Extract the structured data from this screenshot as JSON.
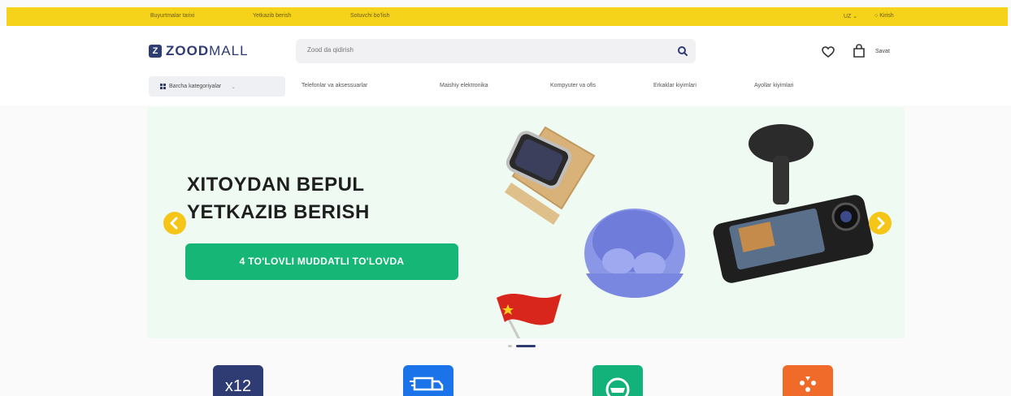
{
  "topbar": {
    "links": [
      "Buyurtmalar tarixi",
      "Yetkazib berish",
      "Sotuvchi bo'lish"
    ],
    "language": "UZ",
    "login": "Kirish"
  },
  "header": {
    "logo_mark": "Z",
    "logo_bold": "ZOOD",
    "logo_light": "MALL",
    "search_placeholder": "Zood da qidirish",
    "basket_label": "Savat"
  },
  "nav": {
    "all_categories": "Barcha kategoriyalar",
    "items": [
      "Telefonlar va aksessuarlar",
      "Maishiy elektronika",
      "Kompyuter va ofis",
      "Erkaklar kiyimlari",
      "Ayollar kiyimlari"
    ]
  },
  "banner": {
    "title": "XITOYDAN BEPUL\nYETKAZIB BERISH",
    "cta": "4 TO'LOVLI MUDDATLI TO'LOVDA",
    "slide_count": 2,
    "active_slide": 2
  },
  "features": [
    {
      "icon": "x12-installment-icon",
      "text": "x12",
      "color": "#2f3c74"
    },
    {
      "icon": "delivery-truck-icon",
      "color": "#1a73e8"
    },
    {
      "icon": "price-tag-icon",
      "color": "#12b27a"
    },
    {
      "icon": "promotion-icon",
      "color": "#f06a2a"
    }
  ],
  "colors": {
    "brand": "#2f3c74",
    "topbar": "#f5d31b",
    "cta": "#16b676",
    "arrow": "#f5c518"
  }
}
